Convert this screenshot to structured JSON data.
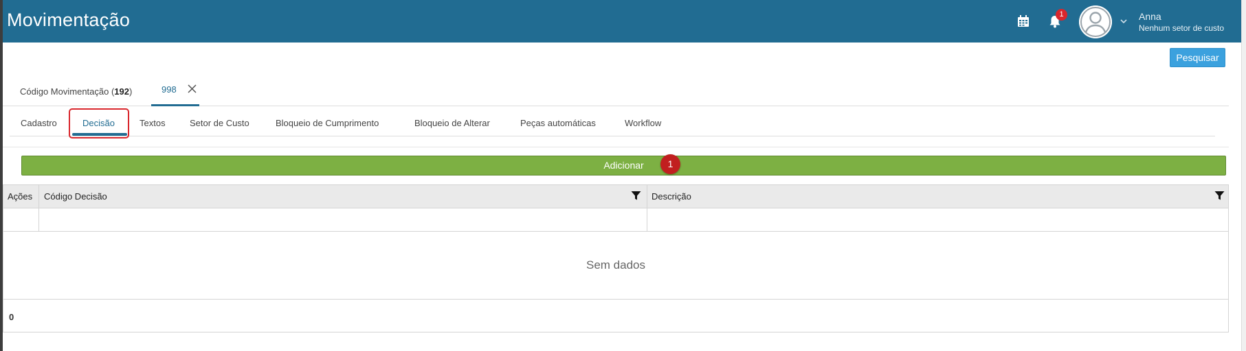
{
  "header": {
    "title": "Movimentação",
    "notification_count": "1",
    "user_name": "Anna",
    "user_sector": "Nenhum setor de custo",
    "icons": [
      "calendar-icon",
      "bell-icon",
      "avatar",
      "chevron-down-icon"
    ],
    "background_color": "#216c92"
  },
  "toolbar": {
    "search_label": "Pesquisar"
  },
  "record_tabs": [
    {
      "label_prefix": "Código Movimentação (",
      "code": "192",
      "label_suffix": ")"
    },
    {
      "label": "998",
      "closable": true,
      "active": true
    }
  ],
  "sub_tabs": [
    {
      "label": "Cadastro"
    },
    {
      "label": "Decisão",
      "active": true
    },
    {
      "label": "Textos"
    },
    {
      "label": "Setor de Custo"
    },
    {
      "label": "Bloqueio de Cumprimento"
    },
    {
      "label": "Bloqueio de Alterar"
    },
    {
      "label": "Peças automáticas"
    },
    {
      "label": "Workflow"
    }
  ],
  "actions": {
    "add_label": "Adicionar",
    "add_badge": "1",
    "add_color": "#7db043"
  },
  "grid": {
    "columns": [
      "Ações",
      "Código Decisão",
      "Descrição"
    ],
    "empty_text": "Sem dados",
    "total": "0"
  }
}
